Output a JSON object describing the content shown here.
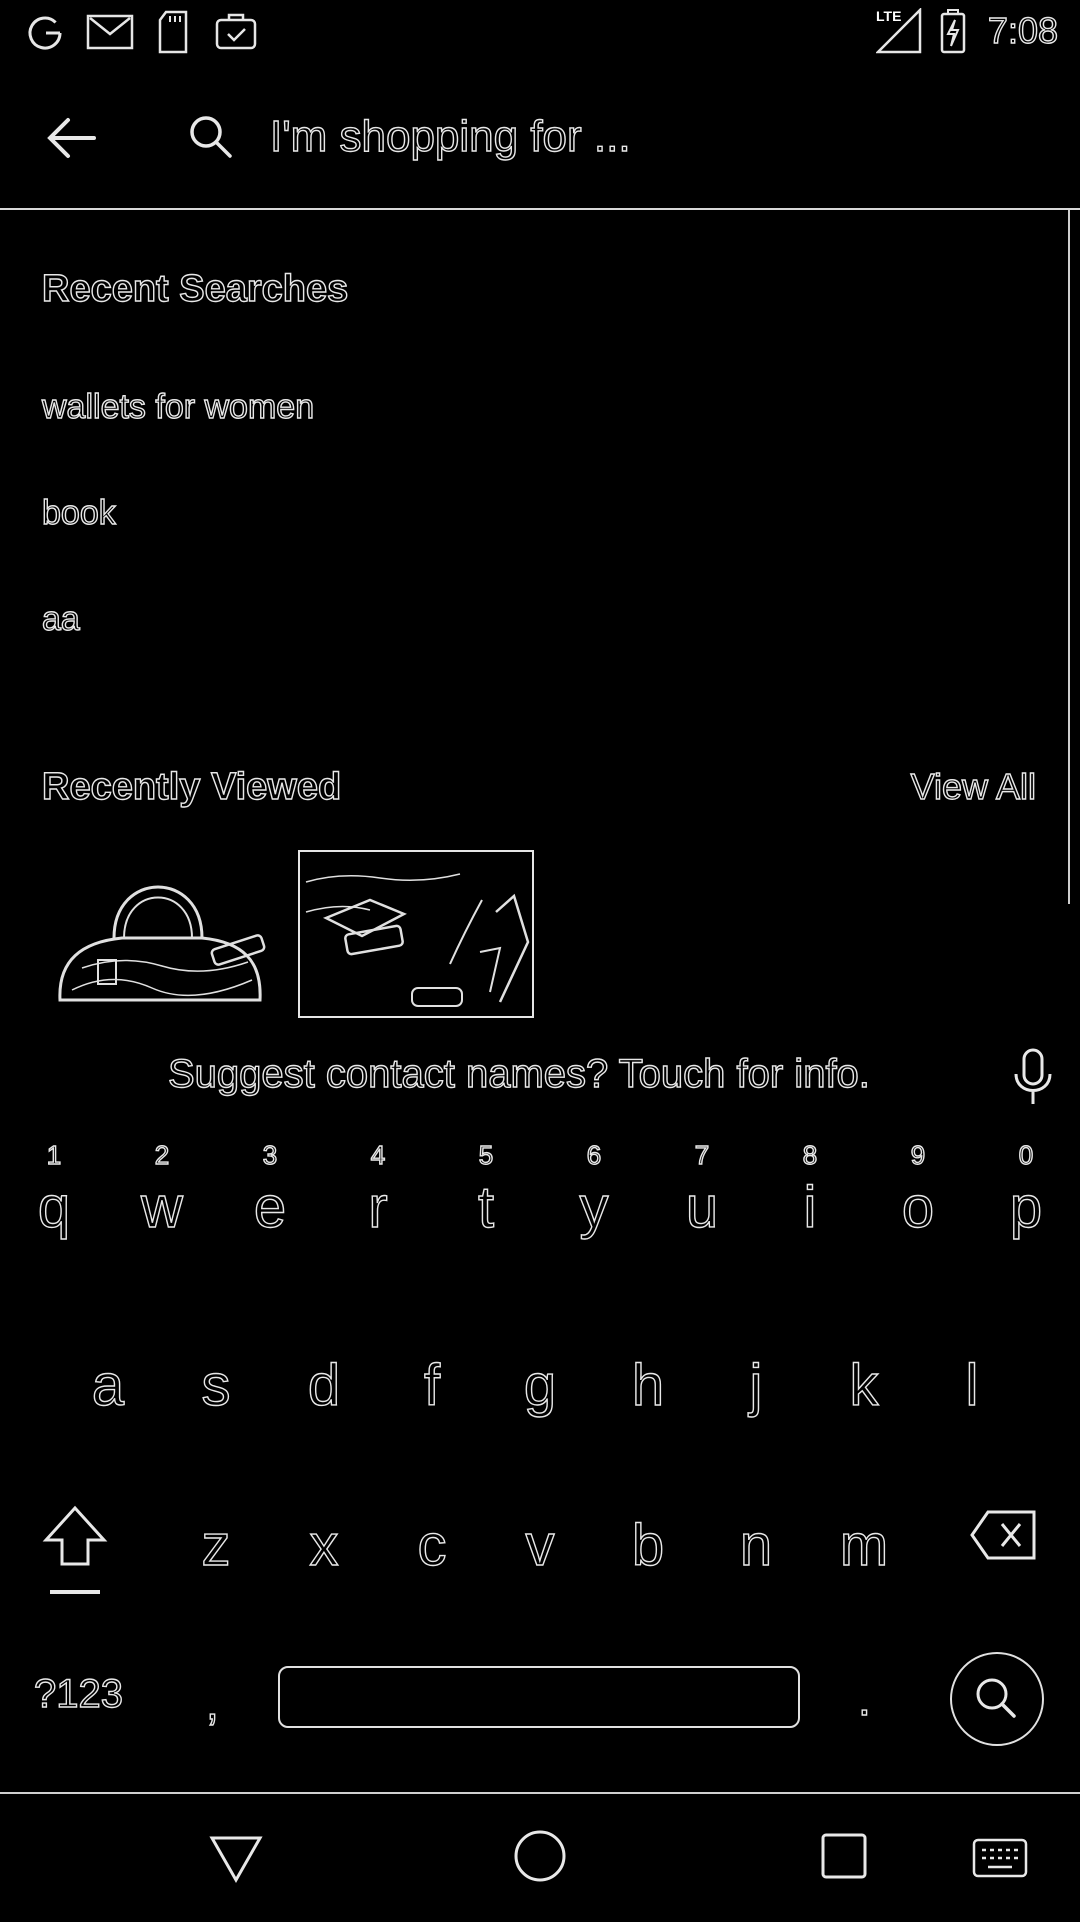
{
  "status_bar": {
    "time": "7:08",
    "network_label": "LTE",
    "icons": [
      "google-icon",
      "gmail-icon",
      "sd-card-icon",
      "briefcase-check-icon",
      "lte-signal-icon",
      "battery-charging-icon"
    ]
  },
  "search": {
    "placeholder": "I'm shopping for ...",
    "back_icon": "arrow-left-icon",
    "search_icon": "search-icon"
  },
  "recent_searches": {
    "title": "Recent Searches",
    "items": [
      "wallets for women",
      "book",
      "aa"
    ]
  },
  "recently_viewed": {
    "title": "Recently Viewed",
    "view_all": "View All",
    "items": [
      {
        "icon": "handbag-icon"
      },
      {
        "icon": "wallet-photo-icon"
      }
    ]
  },
  "keyboard": {
    "suggestion": "Suggest contact names? Touch for info.",
    "rows": [
      [
        {
          "k": "q",
          "h": "1"
        },
        {
          "k": "w",
          "h": "2"
        },
        {
          "k": "e",
          "h": "3"
        },
        {
          "k": "r",
          "h": "4"
        },
        {
          "k": "t",
          "h": "5"
        },
        {
          "k": "y",
          "h": "6"
        },
        {
          "k": "u",
          "h": "7"
        },
        {
          "k": "i",
          "h": "8"
        },
        {
          "k": "o",
          "h": "9"
        },
        {
          "k": "p",
          "h": "0"
        }
      ],
      [
        {
          "k": "a"
        },
        {
          "k": "s"
        },
        {
          "k": "d"
        },
        {
          "k": "f"
        },
        {
          "k": "g"
        },
        {
          "k": "h"
        },
        {
          "k": "j"
        },
        {
          "k": "k"
        },
        {
          "k": "l"
        }
      ],
      [
        {
          "k": "z"
        },
        {
          "k": "x"
        },
        {
          "k": "c"
        },
        {
          "k": "v"
        },
        {
          "k": "b"
        },
        {
          "k": "n"
        },
        {
          "k": "m"
        }
      ]
    ],
    "symbols_label": "?123",
    "comma": ",",
    "period": "."
  },
  "nav": {
    "icons": [
      "back-triangle-icon",
      "home-circle-icon",
      "recents-square-icon",
      "keyboard-icon"
    ]
  },
  "colors": {
    "background": "#000000",
    "outline": "#e8e8e8"
  }
}
